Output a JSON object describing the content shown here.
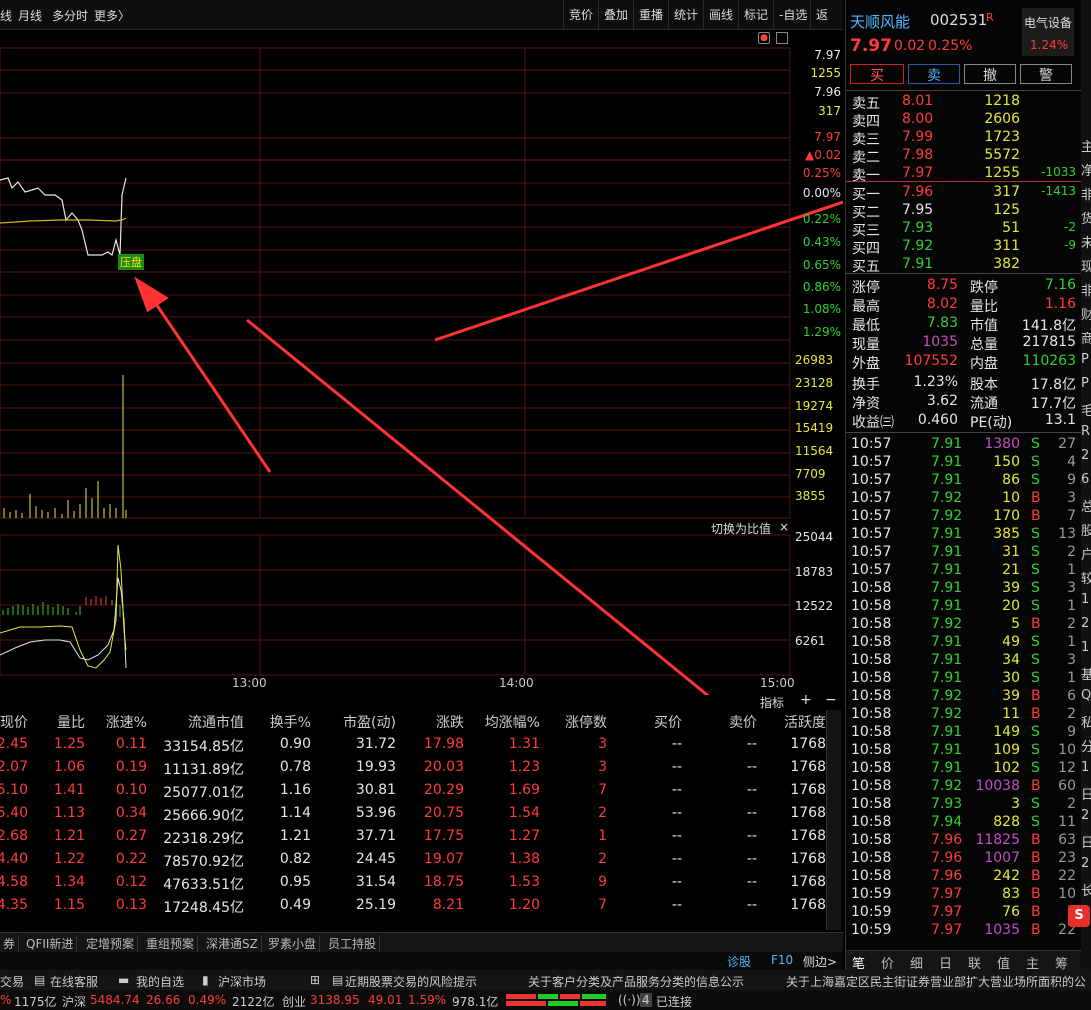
{
  "toolbar": {
    "left_tabs": [
      "线",
      "月线",
      "多分时",
      "更多〉"
    ],
    "buttons": [
      "竞价",
      "叠加",
      "重播",
      "统计",
      "画线",
      "标记",
      "-自选",
      "返回"
    ]
  },
  "chart_data": {
    "type": "line",
    "title": "",
    "time_labels": [
      "13:00",
      "14:00",
      "15:00"
    ],
    "price_right_labels": [
      {
        "text": "7.97",
        "color": "#e6e6e6"
      },
      {
        "text": "1255",
        "color": "#e8e83c"
      },
      {
        "text": "7.96",
        "color": "#e6e6e6"
      },
      {
        "text": "317",
        "color": "#e8e83c"
      },
      {
        "text": "7.97",
        "color": "#ff3b3b"
      },
      {
        "text": "▲0.02",
        "color": "#ff3b3b"
      },
      {
        "text": "0.25%",
        "color": "#ff3b3b"
      },
      {
        "text": "0.00%",
        "color": "#e6e6e6"
      },
      {
        "text": "0.22%",
        "color": "#2fd22f"
      },
      {
        "text": "0.43%",
        "color": "#2fd22f"
      },
      {
        "text": "0.65%",
        "color": "#2fd22f"
      },
      {
        "text": "0.86%",
        "color": "#2fd22f"
      },
      {
        "text": "1.08%",
        "color": "#2fd22f"
      },
      {
        "text": "1.29%",
        "color": "#2fd22f"
      }
    ],
    "volume_labels": [
      "26983",
      "23128",
      "19274",
      "15419",
      "11564",
      "7709",
      "3855"
    ],
    "indicator_labels": [
      "25044",
      "18783",
      "12522",
      "6261"
    ],
    "badge": "压盘",
    "switch_label": "切换为比值",
    "indicator_tab": "指标"
  },
  "table": {
    "headers": [
      "现价",
      "量比",
      "涨速%",
      "流通市值",
      "换手%",
      "市盈(动)",
      "涨跌",
      "均涨幅%",
      "涨停数",
      "买价",
      "卖价",
      "活跃度"
    ],
    "rows": [
      [
        "2.45",
        "1.25",
        "0.11",
        "33154.85亿",
        "0.90",
        "31.72",
        "17.98",
        "1.31",
        "3",
        "--",
        "--",
        "1768"
      ],
      [
        "2.07",
        "1.06",
        "0.19",
        "11131.89亿",
        "0.78",
        "19.93",
        "20.03",
        "1.23",
        "3",
        "--",
        "--",
        "1768"
      ],
      [
        "5.10",
        "1.41",
        "0.10",
        "25077.01亿",
        "1.16",
        "30.81",
        "20.29",
        "1.69",
        "7",
        "--",
        "--",
        "1768"
      ],
      [
        "5.40",
        "1.13",
        "0.34",
        "25666.90亿",
        "1.14",
        "53.96",
        "20.75",
        "1.54",
        "2",
        "--",
        "--",
        "1768"
      ],
      [
        "2.68",
        "1.21",
        "0.27",
        "22318.29亿",
        "1.21",
        "37.71",
        "17.75",
        "1.27",
        "1",
        "--",
        "--",
        "1768"
      ],
      [
        "4.40",
        "1.22",
        "0.22",
        "78570.92亿",
        "0.82",
        "24.45",
        "19.07",
        "1.38",
        "2",
        "--",
        "--",
        "1768"
      ],
      [
        "4.58",
        "1.34",
        "0.12",
        "47633.51亿",
        "0.95",
        "31.54",
        "18.75",
        "1.53",
        "9",
        "--",
        "--",
        "1768"
      ],
      [
        "4.35",
        "1.15",
        "0.13",
        "17248.45亿",
        "0.49",
        "25.19",
        "8.21",
        "1.20",
        "7",
        "--",
        "--",
        "1768"
      ]
    ]
  },
  "bottom_tabs": [
    "券",
    "QFII新进",
    "定增预案",
    "重组预案",
    "深港通SZ",
    "罗素小盘",
    "员工持股"
  ],
  "status_line1": [
    "交易",
    "在线客服",
    "我的自选",
    "沪深市场",
    "近期股票交易的风险提示",
    "关于客户分类及产品服务分类的信息公示",
    "关于上海嘉定区民主街证券营业部扩大营业场所面积的公告"
  ],
  "status_line2": {
    "a": "%",
    "b": "1175亿",
    "sh_label": "沪深",
    "sh_val": "5484.74",
    "sh_chg": "26.66",
    "sh_pct": "0.49%",
    "sh_amt": "2122亿",
    "cy_label": "创业",
    "cy_val": "3138.95",
    "cy_chg": "49.01",
    "cy_pct": "1.59%",
    "cy_amt": "978.1亿",
    "conn_count": "4",
    "conn_label": "已连接"
  },
  "stock": {
    "name": "天顺风能",
    "code": "002531",
    "flag": "R",
    "price": "7.97",
    "change": "0.02",
    "pct": "0.25%",
    "sector": "电气设备",
    "sector_pct": "1.24%",
    "actions": [
      "买",
      "卖",
      "撤",
      "警"
    ]
  },
  "orderbook": {
    "asks": [
      [
        "卖五",
        "8.01",
        "1218",
        ""
      ],
      [
        "卖四",
        "8.00",
        "2606",
        ""
      ],
      [
        "卖三",
        "7.99",
        "1723",
        ""
      ],
      [
        "卖二",
        "7.98",
        "5572",
        ""
      ],
      [
        "卖一",
        "7.97",
        "1255",
        "-1033"
      ]
    ],
    "bids": [
      [
        "买一",
        "7.96",
        "317",
        "-1413"
      ],
      [
        "买二",
        "7.95",
        "125",
        ""
      ],
      [
        "买三",
        "7.93",
        "51",
        "-2"
      ],
      [
        "买四",
        "7.92",
        "311",
        "-9"
      ],
      [
        "买五",
        "7.91",
        "382",
        ""
      ]
    ]
  },
  "stats": [
    [
      "涨停",
      "8.75",
      "跌停",
      "7.16"
    ],
    [
      "最高",
      "8.02",
      "量比",
      "1.16"
    ],
    [
      "最低",
      "7.83",
      "市值",
      "141.8亿"
    ],
    [
      "现量",
      "1035",
      "总量",
      "217815"
    ],
    [
      "外盘",
      "107552",
      "内盘",
      "110263"
    ],
    [
      "换手",
      "1.23%",
      "股本",
      "17.8亿"
    ],
    [
      "净资",
      "3.62",
      "流通",
      "17.7亿"
    ],
    [
      "收益㈢",
      "0.460",
      "PE(动)",
      "13.1"
    ]
  ],
  "ticks": [
    [
      "10:57",
      "7.91",
      "1380",
      "S",
      "27"
    ],
    [
      "10:57",
      "7.91",
      "150",
      "S",
      "4"
    ],
    [
      "10:57",
      "7.91",
      "86",
      "S",
      "9"
    ],
    [
      "10:57",
      "7.92",
      "10",
      "B",
      "3"
    ],
    [
      "10:57",
      "7.92",
      "170",
      "B",
      "7"
    ],
    [
      "10:57",
      "7.91",
      "385",
      "S",
      "13"
    ],
    [
      "10:57",
      "7.91",
      "31",
      "S",
      "2"
    ],
    [
      "10:57",
      "7.91",
      "21",
      "S",
      "1"
    ],
    [
      "10:58",
      "7.91",
      "39",
      "S",
      "3"
    ],
    [
      "10:58",
      "7.91",
      "20",
      "S",
      "1"
    ],
    [
      "10:58",
      "7.92",
      "5",
      "B",
      "2"
    ],
    [
      "10:58",
      "7.91",
      "49",
      "S",
      "1"
    ],
    [
      "10:58",
      "7.91",
      "34",
      "S",
      "3"
    ],
    [
      "10:58",
      "7.91",
      "30",
      "S",
      "1"
    ],
    [
      "10:58",
      "7.92",
      "39",
      "B",
      "6"
    ],
    [
      "10:58",
      "7.92",
      "11",
      "B",
      "2"
    ],
    [
      "10:58",
      "7.91",
      "149",
      "S",
      "9"
    ],
    [
      "10:58",
      "7.91",
      "109",
      "S",
      "10"
    ],
    [
      "10:58",
      "7.91",
      "102",
      "S",
      "12"
    ],
    [
      "10:58",
      "7.92",
      "10038",
      "B",
      "60"
    ],
    [
      "10:58",
      "7.93",
      "3",
      "S",
      "2"
    ],
    [
      "10:58",
      "7.94",
      "828",
      "S",
      "11"
    ],
    [
      "10:58",
      "7.96",
      "11825",
      "B",
      "63"
    ],
    [
      "10:58",
      "7.96",
      "1007",
      "B",
      "23"
    ],
    [
      "10:58",
      "7.96",
      "242",
      "B",
      "22"
    ],
    [
      "10:59",
      "7.97",
      "83",
      "B",
      "10"
    ],
    [
      "10:59",
      "7.97",
      "76",
      "B",
      "7"
    ],
    [
      "10:59",
      "7.97",
      "1035",
      "B",
      "22"
    ]
  ],
  "right_tabs": [
    "笔",
    "价",
    "细",
    "日",
    "联",
    "值",
    "主",
    "筹"
  ],
  "chart_footer": [
    "诊股",
    "F10",
    "侧边>"
  ],
  "far_right_chars": [
    "主",
    "净",
    "非",
    "货",
    "未",
    "现",
    "非",
    "财",
    "商",
    "P",
    "P",
    "毛",
    "R",
    "2",
    "6",
    "总",
    "股",
    "户",
    "较",
    "1",
    "2",
    "1",
    "基",
    "Q",
    "私",
    "分",
    "1",
    "日",
    "2",
    "日",
    "2",
    "长"
  ]
}
